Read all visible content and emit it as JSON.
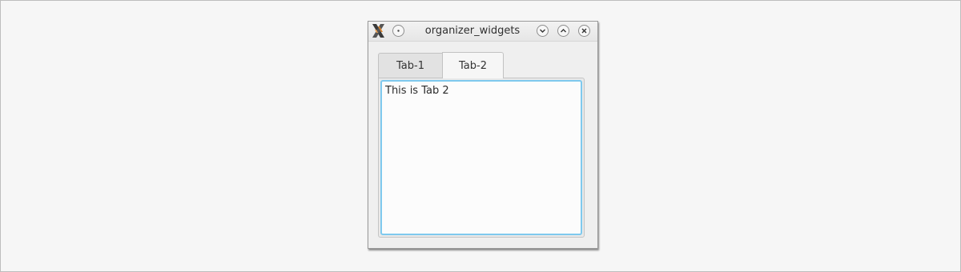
{
  "window": {
    "title": "organizer_widgets",
    "app_icon": "x-logo-icon",
    "buttons": {
      "menu": "menu-dot-icon",
      "minimize": "chevron-down-icon",
      "maximize": "chevron-up-icon",
      "close": "close-icon"
    }
  },
  "tabs": [
    {
      "label": "Tab-1",
      "active": false
    },
    {
      "label": "Tab-2",
      "active": true
    }
  ],
  "tab_content": {
    "text": "This is Tab 2"
  },
  "colors": {
    "focus_border": "#7ec9ee",
    "window_bg": "#efefef"
  }
}
